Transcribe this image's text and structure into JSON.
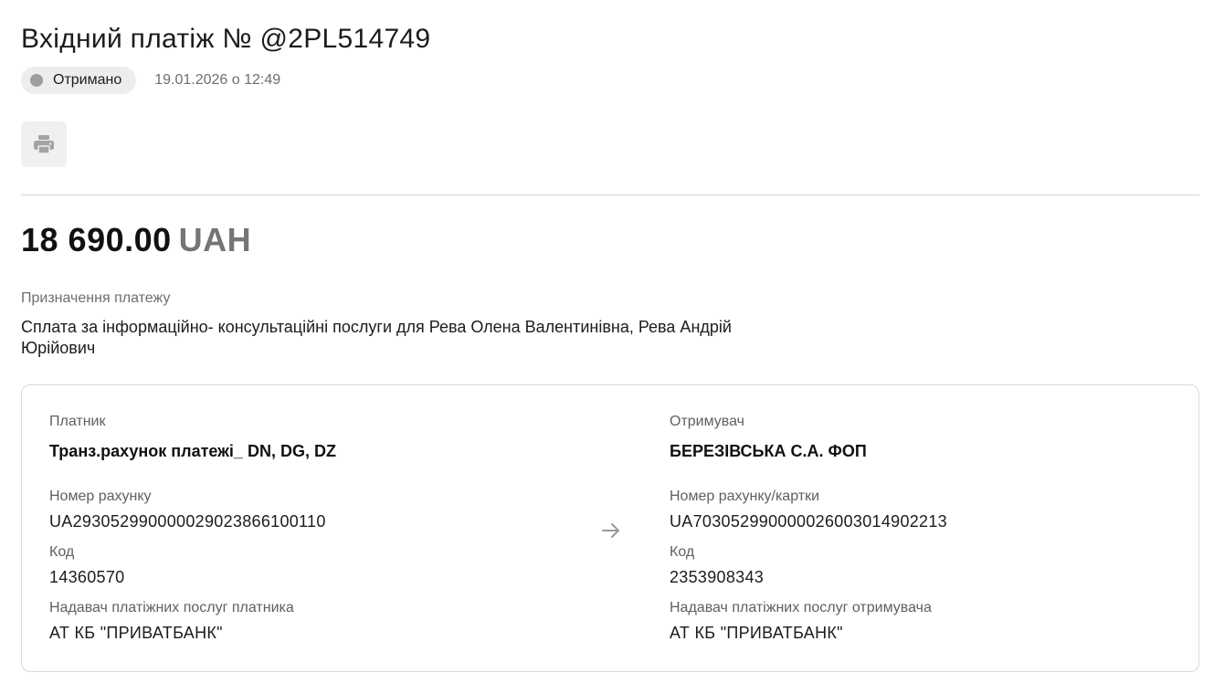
{
  "header": {
    "title": "Вхідний платіж № @2PL514749",
    "status_label": "Отримано",
    "status_color": "#9e9e9e",
    "date": "19.01.2026 о 12:49"
  },
  "toolbar": {
    "print_icon": "printer-icon"
  },
  "amount": {
    "value": "18 690.00",
    "currency": "UAH"
  },
  "purpose": {
    "label": "Призначення платежу",
    "text": "Сплата за інформаційно- консультаційні послуги для Рева Олена Валентинівна, Рева Андрій Юрійович"
  },
  "payer": {
    "label": "Платник",
    "name": "Транз.рахунок платежі_ DN, DG, DZ",
    "account_label": "Номер рахунку",
    "account": "UA293052990000029023866100110",
    "code_label": "Код",
    "code": "14360570",
    "provider_label": "Надавач платіжних послуг платника",
    "provider": "АТ КБ \"ПРИВАТБАНК\""
  },
  "recipient": {
    "label": "Отримувач",
    "name": "БЕРЕЗІВСЬКА С.А. ФОП",
    "account_label": "Номер рахунку/картки",
    "account": "UA703052990000026003014902213",
    "code_label": "Код",
    "code": "2353908343",
    "provider_label": "Надавач платіжних послуг отримувача",
    "provider": "АТ КБ \"ПРИВАТБАНК\""
  },
  "icons": {
    "transfer": "arrow-right-icon"
  }
}
